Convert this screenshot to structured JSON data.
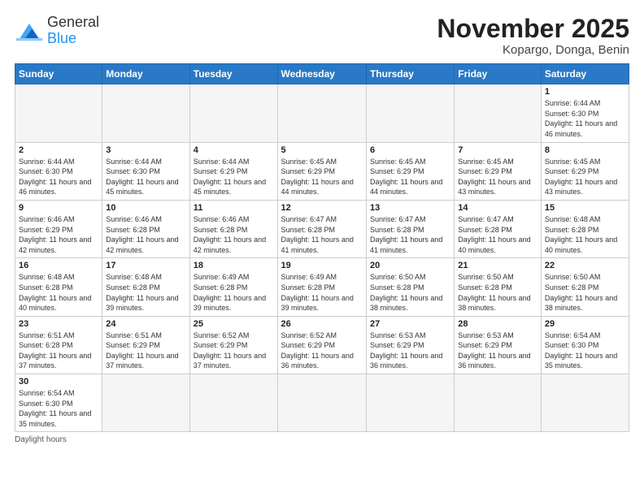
{
  "header": {
    "logo_general": "General",
    "logo_blue": "Blue",
    "month_title": "November 2025",
    "location": "Kopargo, Donga, Benin"
  },
  "days_of_week": [
    "Sunday",
    "Monday",
    "Tuesday",
    "Wednesday",
    "Thursday",
    "Friday",
    "Saturday"
  ],
  "footer_label": "Daylight hours",
  "weeks": [
    [
      {
        "day": "",
        "sunrise": "",
        "sunset": "",
        "daylight": "",
        "empty": true
      },
      {
        "day": "",
        "sunrise": "",
        "sunset": "",
        "daylight": "",
        "empty": true
      },
      {
        "day": "",
        "sunrise": "",
        "sunset": "",
        "daylight": "",
        "empty": true
      },
      {
        "day": "",
        "sunrise": "",
        "sunset": "",
        "daylight": "",
        "empty": true
      },
      {
        "day": "",
        "sunrise": "",
        "sunset": "",
        "daylight": "",
        "empty": true
      },
      {
        "day": "",
        "sunrise": "",
        "sunset": "",
        "daylight": "",
        "empty": true
      },
      {
        "day": "1",
        "sunrise": "6:44 AM",
        "sunset": "6:30 PM",
        "daylight": "11 hours and 46 minutes.",
        "empty": false
      }
    ],
    [
      {
        "day": "2",
        "sunrise": "6:44 AM",
        "sunset": "6:30 PM",
        "daylight": "11 hours and 46 minutes.",
        "empty": false
      },
      {
        "day": "3",
        "sunrise": "6:44 AM",
        "sunset": "6:30 PM",
        "daylight": "11 hours and 45 minutes.",
        "empty": false
      },
      {
        "day": "4",
        "sunrise": "6:44 AM",
        "sunset": "6:29 PM",
        "daylight": "11 hours and 45 minutes.",
        "empty": false
      },
      {
        "day": "5",
        "sunrise": "6:45 AM",
        "sunset": "6:29 PM",
        "daylight": "11 hours and 44 minutes.",
        "empty": false
      },
      {
        "day": "6",
        "sunrise": "6:45 AM",
        "sunset": "6:29 PM",
        "daylight": "11 hours and 44 minutes.",
        "empty": false
      },
      {
        "day": "7",
        "sunrise": "6:45 AM",
        "sunset": "6:29 PM",
        "daylight": "11 hours and 43 minutes.",
        "empty": false
      },
      {
        "day": "8",
        "sunrise": "6:45 AM",
        "sunset": "6:29 PM",
        "daylight": "11 hours and 43 minutes.",
        "empty": false
      }
    ],
    [
      {
        "day": "9",
        "sunrise": "6:46 AM",
        "sunset": "6:29 PM",
        "daylight": "11 hours and 42 minutes.",
        "empty": false
      },
      {
        "day": "10",
        "sunrise": "6:46 AM",
        "sunset": "6:28 PM",
        "daylight": "11 hours and 42 minutes.",
        "empty": false
      },
      {
        "day": "11",
        "sunrise": "6:46 AM",
        "sunset": "6:28 PM",
        "daylight": "11 hours and 42 minutes.",
        "empty": false
      },
      {
        "day": "12",
        "sunrise": "6:47 AM",
        "sunset": "6:28 PM",
        "daylight": "11 hours and 41 minutes.",
        "empty": false
      },
      {
        "day": "13",
        "sunrise": "6:47 AM",
        "sunset": "6:28 PM",
        "daylight": "11 hours and 41 minutes.",
        "empty": false
      },
      {
        "day": "14",
        "sunrise": "6:47 AM",
        "sunset": "6:28 PM",
        "daylight": "11 hours and 40 minutes.",
        "empty": false
      },
      {
        "day": "15",
        "sunrise": "6:48 AM",
        "sunset": "6:28 PM",
        "daylight": "11 hours and 40 minutes.",
        "empty": false
      }
    ],
    [
      {
        "day": "16",
        "sunrise": "6:48 AM",
        "sunset": "6:28 PM",
        "daylight": "11 hours and 40 minutes.",
        "empty": false
      },
      {
        "day": "17",
        "sunrise": "6:48 AM",
        "sunset": "6:28 PM",
        "daylight": "11 hours and 39 minutes.",
        "empty": false
      },
      {
        "day": "18",
        "sunrise": "6:49 AM",
        "sunset": "6:28 PM",
        "daylight": "11 hours and 39 minutes.",
        "empty": false
      },
      {
        "day": "19",
        "sunrise": "6:49 AM",
        "sunset": "6:28 PM",
        "daylight": "11 hours and 39 minutes.",
        "empty": false
      },
      {
        "day": "20",
        "sunrise": "6:50 AM",
        "sunset": "6:28 PM",
        "daylight": "11 hours and 38 minutes.",
        "empty": false
      },
      {
        "day": "21",
        "sunrise": "6:50 AM",
        "sunset": "6:28 PM",
        "daylight": "11 hours and 38 minutes.",
        "empty": false
      },
      {
        "day": "22",
        "sunrise": "6:50 AM",
        "sunset": "6:28 PM",
        "daylight": "11 hours and 38 minutes.",
        "empty": false
      }
    ],
    [
      {
        "day": "23",
        "sunrise": "6:51 AM",
        "sunset": "6:28 PM",
        "daylight": "11 hours and 37 minutes.",
        "empty": false
      },
      {
        "day": "24",
        "sunrise": "6:51 AM",
        "sunset": "6:29 PM",
        "daylight": "11 hours and 37 minutes.",
        "empty": false
      },
      {
        "day": "25",
        "sunrise": "6:52 AM",
        "sunset": "6:29 PM",
        "daylight": "11 hours and 37 minutes.",
        "empty": false
      },
      {
        "day": "26",
        "sunrise": "6:52 AM",
        "sunset": "6:29 PM",
        "daylight": "11 hours and 36 minutes.",
        "empty": false
      },
      {
        "day": "27",
        "sunrise": "6:53 AM",
        "sunset": "6:29 PM",
        "daylight": "11 hours and 36 minutes.",
        "empty": false
      },
      {
        "day": "28",
        "sunrise": "6:53 AM",
        "sunset": "6:29 PM",
        "daylight": "11 hours and 36 minutes.",
        "empty": false
      },
      {
        "day": "29",
        "sunrise": "6:54 AM",
        "sunset": "6:30 PM",
        "daylight": "11 hours and 35 minutes.",
        "empty": false
      }
    ],
    [
      {
        "day": "30",
        "sunrise": "6:54 AM",
        "sunset": "6:30 PM",
        "daylight": "11 hours and 35 minutes.",
        "empty": false
      },
      {
        "day": "",
        "sunrise": "",
        "sunset": "",
        "daylight": "",
        "empty": true
      },
      {
        "day": "",
        "sunrise": "",
        "sunset": "",
        "daylight": "",
        "empty": true
      },
      {
        "day": "",
        "sunrise": "",
        "sunset": "",
        "daylight": "",
        "empty": true
      },
      {
        "day": "",
        "sunrise": "",
        "sunset": "",
        "daylight": "",
        "empty": true
      },
      {
        "day": "",
        "sunrise": "",
        "sunset": "",
        "daylight": "",
        "empty": true
      },
      {
        "day": "",
        "sunrise": "",
        "sunset": "",
        "daylight": "",
        "empty": true
      }
    ]
  ]
}
